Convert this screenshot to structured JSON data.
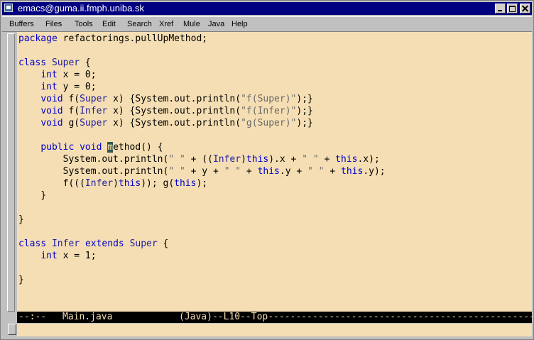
{
  "window": {
    "title": "emacs@guma.ii.fmph.uniba.sk"
  },
  "menubar": {
    "items": [
      "Buffers",
      "Files",
      "Tools",
      "Edit",
      "Search",
      "Xref",
      "Mule",
      "Java",
      "Help"
    ]
  },
  "editor": {
    "lines": [
      [
        {
          "t": "package ",
          "c": "kw"
        },
        {
          "t": "refactorings.pullUpMethod;",
          "c": ""
        }
      ],
      [],
      [
        {
          "t": "class ",
          "c": "kw"
        },
        {
          "t": "Super",
          "c": "ty"
        },
        {
          "t": " {",
          "c": ""
        }
      ],
      [
        {
          "t": "    ",
          "c": ""
        },
        {
          "t": "int",
          "c": "kw"
        },
        {
          "t": " x = 0;",
          "c": ""
        }
      ],
      [
        {
          "t": "    ",
          "c": ""
        },
        {
          "t": "int",
          "c": "kw"
        },
        {
          "t": " y = 0;",
          "c": ""
        }
      ],
      [
        {
          "t": "    ",
          "c": ""
        },
        {
          "t": "void",
          "c": "kw"
        },
        {
          "t": " f(",
          "c": ""
        },
        {
          "t": "Super",
          "c": "ty"
        },
        {
          "t": " x) {System.out.println(",
          "c": ""
        },
        {
          "t": "\"f(Super)\"",
          "c": "str"
        },
        {
          "t": ");}",
          "c": ""
        }
      ],
      [
        {
          "t": "    ",
          "c": ""
        },
        {
          "t": "void",
          "c": "kw"
        },
        {
          "t": " f(",
          "c": ""
        },
        {
          "t": "Infer",
          "c": "ty"
        },
        {
          "t": " x) {System.out.println(",
          "c": ""
        },
        {
          "t": "\"f(Infer)\"",
          "c": "str"
        },
        {
          "t": ");}",
          "c": ""
        }
      ],
      [
        {
          "t": "    ",
          "c": ""
        },
        {
          "t": "void",
          "c": "kw"
        },
        {
          "t": " g(",
          "c": ""
        },
        {
          "t": "Super",
          "c": "ty"
        },
        {
          "t": " x) {System.out.println(",
          "c": ""
        },
        {
          "t": "\"g(Super)\"",
          "c": "str"
        },
        {
          "t": ");}",
          "c": ""
        }
      ],
      [],
      [
        {
          "t": "    ",
          "c": ""
        },
        {
          "t": "public void ",
          "c": "kw"
        },
        {
          "t": "m",
          "c": "cursor"
        },
        {
          "t": "ethod() {",
          "c": ""
        }
      ],
      [
        {
          "t": "        System.out.println(",
          "c": ""
        },
        {
          "t": "\" \"",
          "c": "str"
        },
        {
          "t": " + ((",
          "c": ""
        },
        {
          "t": "Infer",
          "c": "ty"
        },
        {
          "t": ")",
          "c": ""
        },
        {
          "t": "this",
          "c": "kw"
        },
        {
          "t": ").x + ",
          "c": ""
        },
        {
          "t": "\" \"",
          "c": "str"
        },
        {
          "t": " + ",
          "c": ""
        },
        {
          "t": "this",
          "c": "kw"
        },
        {
          "t": ".x);",
          "c": ""
        }
      ],
      [
        {
          "t": "        System.out.println(",
          "c": ""
        },
        {
          "t": "\" \"",
          "c": "str"
        },
        {
          "t": " + y + ",
          "c": ""
        },
        {
          "t": "\" \"",
          "c": "str"
        },
        {
          "t": " + ",
          "c": ""
        },
        {
          "t": "this",
          "c": "kw"
        },
        {
          "t": ".y + ",
          "c": ""
        },
        {
          "t": "\" \"",
          "c": "str"
        },
        {
          "t": " + ",
          "c": ""
        },
        {
          "t": "this",
          "c": "kw"
        },
        {
          "t": ".y);",
          "c": ""
        }
      ],
      [
        {
          "t": "        f(((",
          "c": ""
        },
        {
          "t": "Infer",
          "c": "ty"
        },
        {
          "t": ")",
          "c": ""
        },
        {
          "t": "this",
          "c": "kw"
        },
        {
          "t": ")); g(",
          "c": ""
        },
        {
          "t": "this",
          "c": "kw"
        },
        {
          "t": ");",
          "c": ""
        }
      ],
      [
        {
          "t": "    }",
          "c": ""
        }
      ],
      [],
      [
        {
          "t": "}",
          "c": ""
        }
      ],
      [],
      [
        {
          "t": "class ",
          "c": "kw"
        },
        {
          "t": "Infer",
          "c": "ty"
        },
        {
          "t": " ",
          "c": ""
        },
        {
          "t": "extends ",
          "c": "kw"
        },
        {
          "t": "Super",
          "c": "ty"
        },
        {
          "t": " {",
          "c": ""
        }
      ],
      [
        {
          "t": "    ",
          "c": ""
        },
        {
          "t": "int",
          "c": "kw"
        },
        {
          "t": " x = 1;",
          "c": ""
        }
      ],
      [],
      [
        {
          "t": "}",
          "c": ""
        }
      ]
    ]
  },
  "modeline": {
    "status": "--:--",
    "buffer": "Main.java",
    "position": "(Java)--L10--Top--------------------------------------------------------"
  },
  "minibuffer": {
    "text": ""
  }
}
